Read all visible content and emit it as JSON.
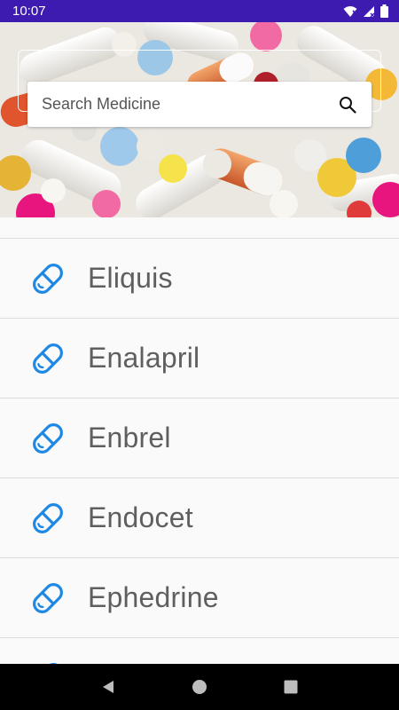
{
  "status_bar": {
    "time": "10:07",
    "icons": [
      "wifi-icon",
      "signal-icon",
      "battery-icon"
    ]
  },
  "hero": {
    "image": "pills-background-image"
  },
  "search": {
    "placeholder": "Search Medicine",
    "icon": "search-icon"
  },
  "medicines": {
    "icon": "pill-icon",
    "accent_color": "#1e88e5",
    "items": [
      {
        "label": "Eliquis"
      },
      {
        "label": "Enalapril"
      },
      {
        "label": "Enbrel"
      },
      {
        "label": "Endocet"
      },
      {
        "label": "Ephedrine"
      }
    ]
  },
  "nav_bar": {
    "buttons": [
      "back-icon",
      "home-icon",
      "recents-icon"
    ]
  }
}
